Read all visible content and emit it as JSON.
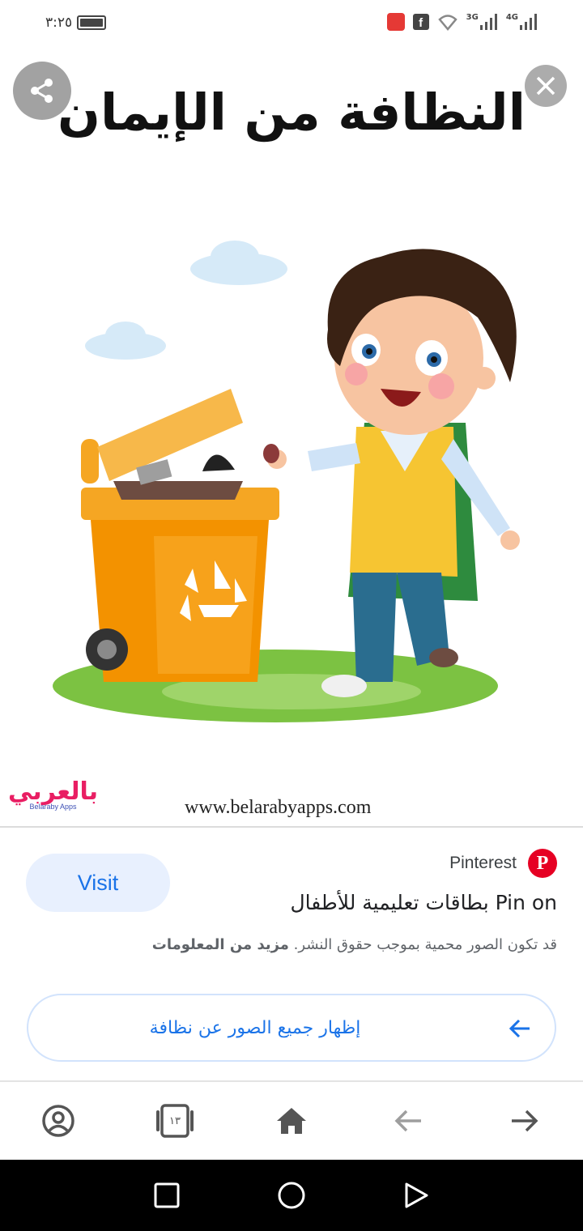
{
  "status_bar": {
    "time": "٣:٢٥",
    "network_3g": "3G",
    "network_4g": "4G",
    "facebook_badge": "f"
  },
  "image": {
    "title": "النظافة من الإيمان",
    "logo_arabic": "بالعربي",
    "logo_english": "Belaraby Apps",
    "website": "www.belarabyapps.com"
  },
  "info": {
    "visit_label": "Visit",
    "source_name": "Pinterest",
    "pin_logo": "P",
    "pin_title": "Pin on بطاقات تعليمية للأطفال",
    "copyright_text": "قد تكون الصور محمية بموجب حقوق النشر.",
    "more_info_label": "مزيد من المعلومات",
    "show_all_label": "إظهار جميع الصور عن نظافة"
  },
  "toolbar": {
    "tabs_count": "١٣"
  },
  "colors": {
    "accent_blue": "#1a73e8",
    "visit_bg": "#e8f0fe",
    "pinterest_red": "#e60023"
  },
  "icons": {
    "share": "share-icon",
    "close": "close-icon",
    "account": "account-icon",
    "tabs": "tabs-icon",
    "home": "home-icon",
    "back": "back-arrow-icon",
    "forward": "forward-arrow-icon",
    "recents": "recents-square-icon",
    "sys_home": "home-circle-icon",
    "sys_back": "back-triangle-icon"
  }
}
